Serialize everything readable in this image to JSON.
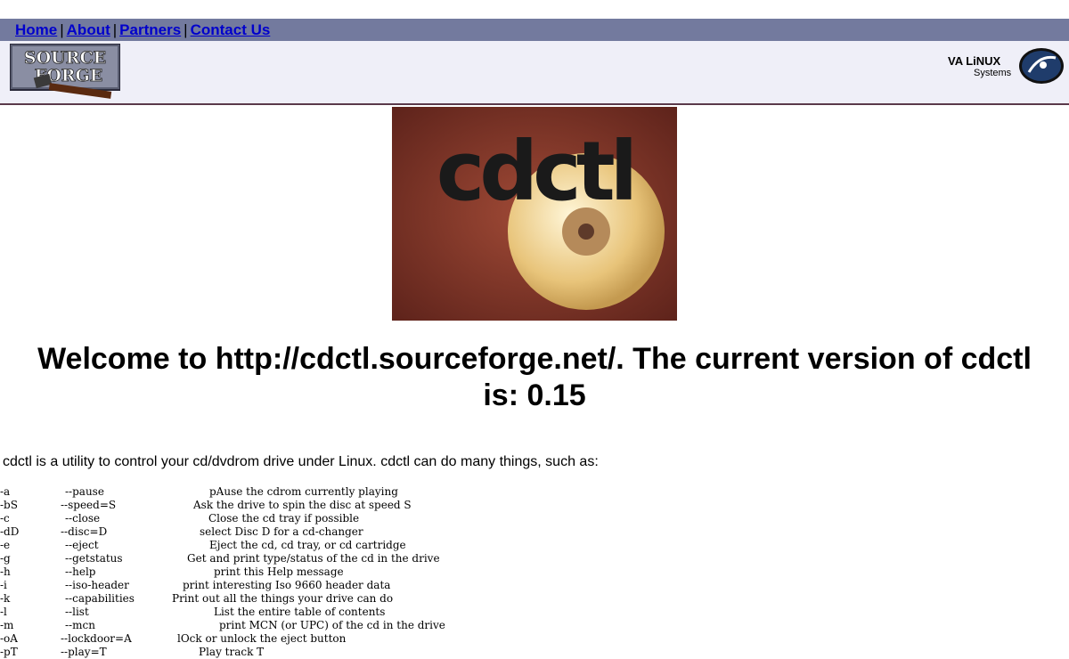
{
  "nav": {
    "links": [
      "Home",
      "About",
      "Partners",
      "Contact Us"
    ],
    "separator": "|"
  },
  "header": {
    "sourceforge_logo": [
      "SOURCE",
      "FORGE"
    ],
    "va_logo": {
      "brand": "VA LiNUX",
      "sub": "Systems"
    }
  },
  "hero": {
    "logo_text": "cdctl"
  },
  "main": {
    "heading": "Welcome to http://cdctl.sourceforge.net/.  The current version of cdctl is: 0.15",
    "intro": "cdctl is a utility to control your cd/dvdrom drive under Linux.  cdctl can do many things, such as:",
    "options": [
      {
        "short": "-a",
        "long": "--pause",
        "desc": "pAuse the cdrom currently playing"
      },
      {
        "short": "-bS",
        "long": "--speed=S",
        "desc": "Ask the drive to spin the disc at speed S"
      },
      {
        "short": "-c",
        "long": "--close",
        "desc": "Close the cd tray if possible"
      },
      {
        "short": "-dD",
        "long": "--disc=D",
        "desc": "select Disc D for a cd-changer"
      },
      {
        "short": "-e",
        "long": "--eject",
        "desc": "Eject the cd, cd tray, or cd cartridge"
      },
      {
        "short": "-g",
        "long": "--getstatus",
        "desc": "Get and print type/status of the cd in the drive"
      },
      {
        "short": "-h",
        "long": "--help",
        "desc": "print this Help message"
      },
      {
        "short": "-i",
        "long": "--iso-header",
        "desc": "print interesting Iso 9660 header data"
      },
      {
        "short": "-k",
        "long": "--capabilities",
        "desc": "Print out all the things your drive can do"
      },
      {
        "short": "-l",
        "long": "--list",
        "desc": "List the entire table of contents"
      },
      {
        "short": "-m",
        "long": "--mcn",
        "desc": "print MCN (or UPC) of the cd in the drive"
      },
      {
        "short": "-oA",
        "long": "--lockdoor=A",
        "desc": "lOck or unlock the eject button"
      },
      {
        "short": "-pT",
        "long": "--play=T",
        "desc": "Play track T"
      }
    ]
  }
}
